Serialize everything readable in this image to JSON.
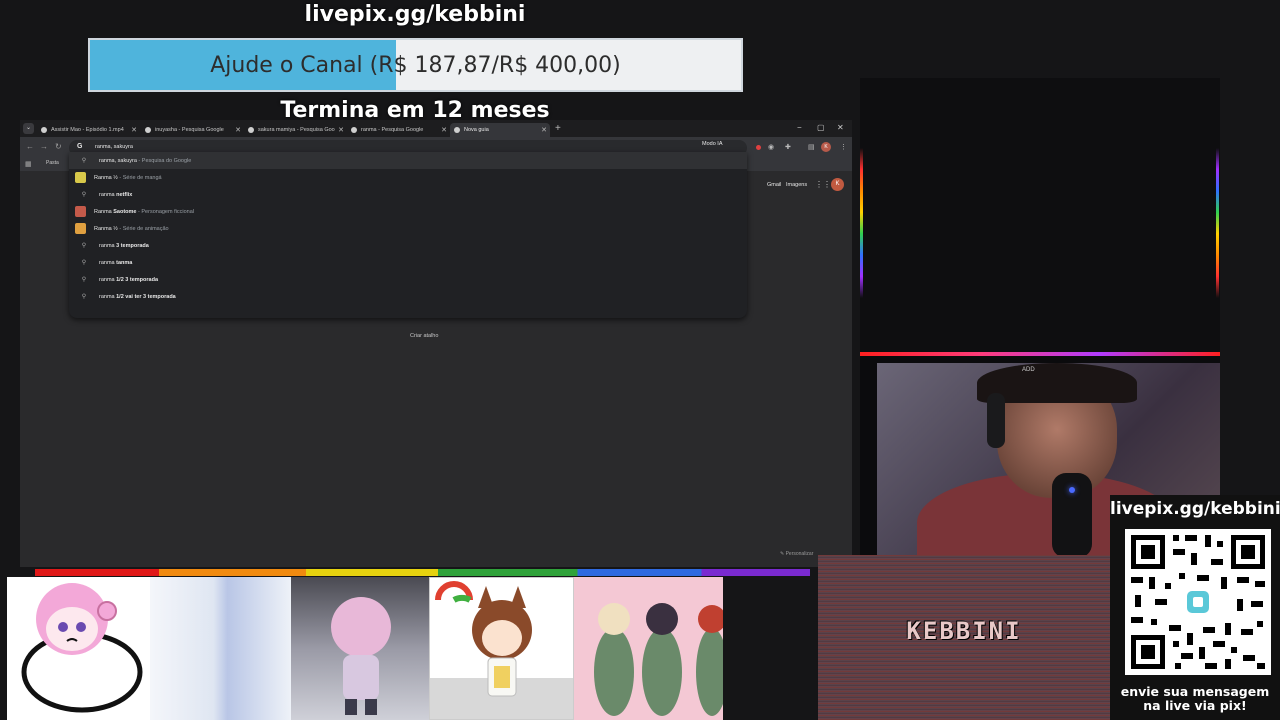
{
  "overlay": {
    "top_link": "livepix.gg/kebbini",
    "goal_text": "Ajude o Canal (R$ 187,87/R$ 400,00)",
    "goal_progress": 0.47,
    "goal_fill_color": "#4fb4dc",
    "goal_end": "Termina em 12 meses"
  },
  "browser": {
    "tabs": [
      {
        "label": "Assistir Mao - Episódio 1.mp4",
        "icon": "globe-icon",
        "active": false
      },
      {
        "label": "inuyasha - Pesquisa Google",
        "icon": "google-icon",
        "active": false
      },
      {
        "label": "sakura mamiya - Pesquisa Goo",
        "icon": "google-icon",
        "active": false
      },
      {
        "label": "ranma - Pesquisa Google",
        "icon": "google-icon",
        "active": false
      },
      {
        "label": "Nova guia",
        "icon": "new-tab-icon",
        "active": true
      }
    ],
    "new_tab_symbol": "+",
    "window_controls": [
      "−",
      "▢",
      "✕"
    ],
    "address_value": "ranma, sakuyra",
    "modo_ia_label": "Modo IA",
    "account_initial": "K",
    "bookmarks_folder": "Pasta",
    "suggestions": [
      {
        "prefix": "ranma, sakuyra",
        "bold": "",
        "sub": " - Pesquisa do Google",
        "type": "search",
        "highlighted": true
      },
      {
        "prefix": "Ranma ½",
        "bold": "",
        "sub": " - Série de mangá",
        "type": "thumb",
        "thumb_color": "#d8c84a"
      },
      {
        "prefix": "ranma ",
        "bold": "netflix",
        "sub": "",
        "type": "search"
      },
      {
        "prefix": "Ranma ",
        "bold": "Saotome",
        "sub": " - Personagem ficcional",
        "type": "thumb",
        "thumb_color": "#c45a4a"
      },
      {
        "prefix": "Ranma ½",
        "bold": "",
        "sub": " - Série de animação",
        "type": "thumb",
        "thumb_color": "#e0a040"
      },
      {
        "prefix": "ranma ",
        "bold": "3 temporada",
        "sub": "",
        "type": "search"
      },
      {
        "prefix": "ranma ",
        "bold": "tanma",
        "sub": "",
        "type": "search"
      },
      {
        "prefix": "ranma ",
        "bold": "1/2 3 temporada",
        "sub": "",
        "type": "search"
      },
      {
        "prefix": "ranma ",
        "bold": "1/2 vai ter 3 temporada",
        "sub": "",
        "type": "search"
      }
    ],
    "gmail_label": "Gmail",
    "imagens_label": "Imagens",
    "create_shortcut_label": "Criar atalho",
    "customize_label": "✎ Personalizar"
  },
  "stream": {
    "kebbini_label": "KEBBINI",
    "qr_title": "livepix.gg/kebbini",
    "qr_footer": "envie sua mensagem na live via pix!",
    "cam_overlay_text": "ADD"
  }
}
